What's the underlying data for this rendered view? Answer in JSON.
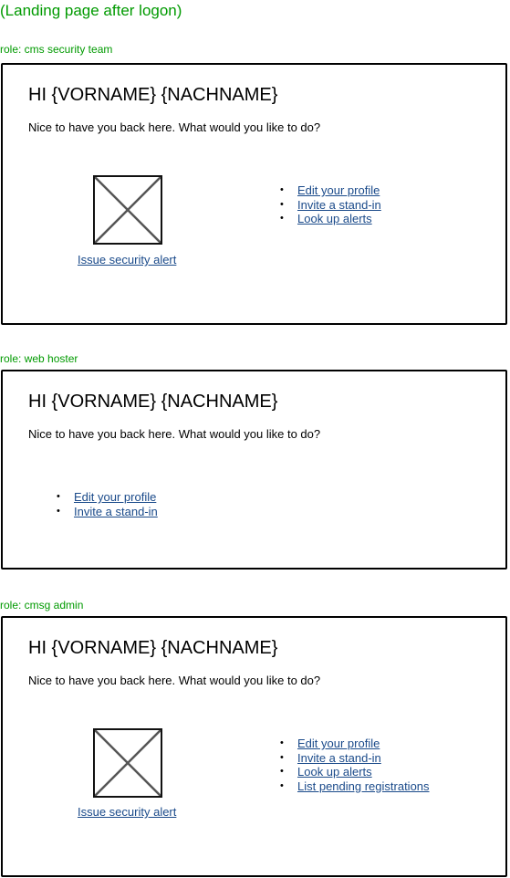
{
  "page_title": "(Landing page after logon)",
  "sections": [
    {
      "role": "role: cms security team",
      "greeting": "HI {VORNAME} {NACHNAME}",
      "intro": "Nice to have you back here. What would you like to do?",
      "image_link": "Issue security alert",
      "links": [
        "Edit your profile",
        "Invite a stand-in",
        "Look up alerts"
      ]
    },
    {
      "role": "role: web hoster",
      "greeting": "HI {VORNAME} {NACHNAME}",
      "intro": "Nice to have you back here. What would you like to do?",
      "links": [
        "Edit your profile",
        "Invite a stand-in"
      ]
    },
    {
      "role": "role: cmsg admin",
      "greeting": "HI {VORNAME} {NACHNAME}",
      "intro": "Nice to have you back here. What would you like to do?",
      "image_link": "Issue security alert",
      "links": [
        "Edit your profile",
        "Invite a stand-in",
        "Look up alerts",
        "List pending registrations"
      ]
    }
  ]
}
